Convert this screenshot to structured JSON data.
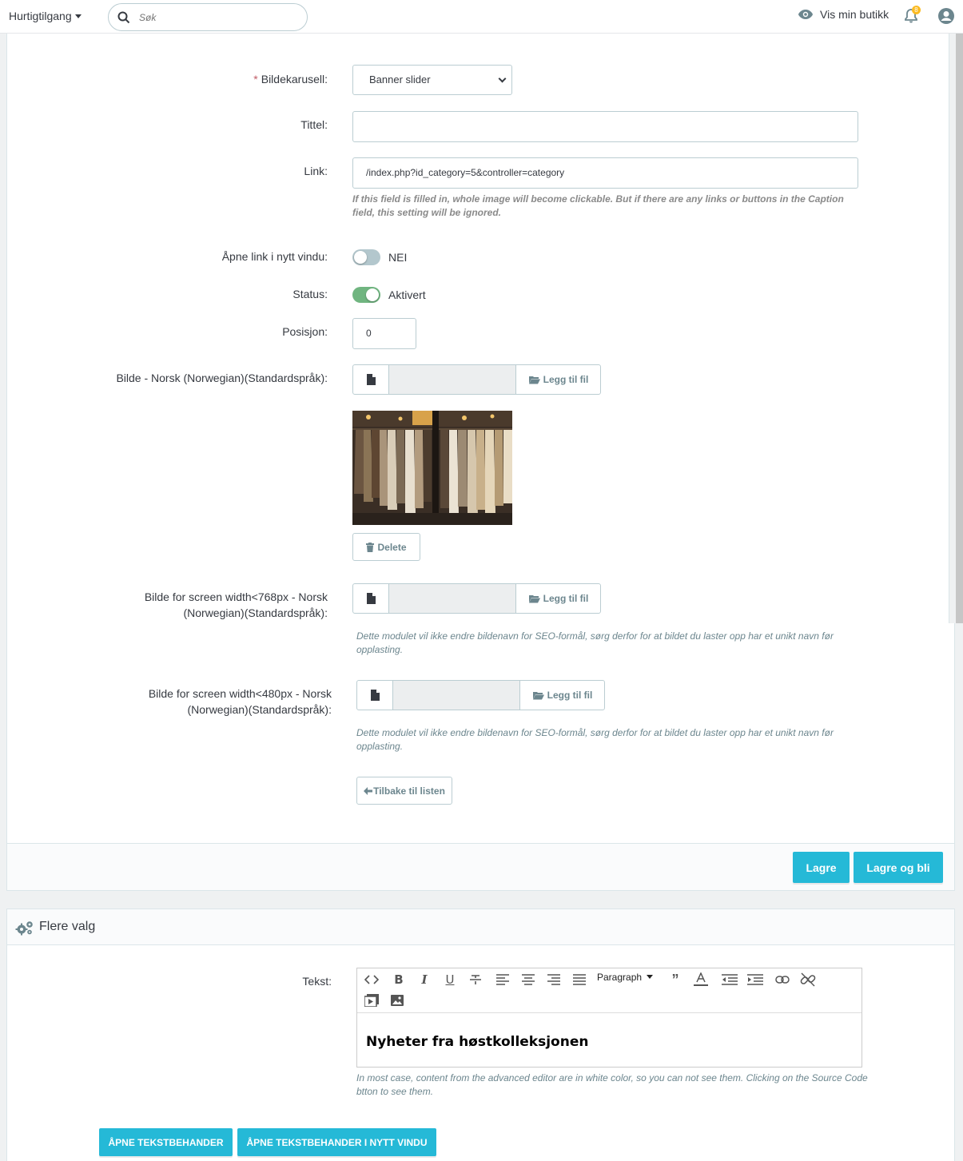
{
  "topbar": {
    "quick_access": "Hurtigtilgang",
    "search_placeholder": "Søk",
    "view_shop": "Vis min butikk",
    "notification_count": "8"
  },
  "form": {
    "carousel_label": "Bildekarusell:",
    "carousel_value": "Banner slider",
    "title_label": "Tittel:",
    "title_value": "",
    "link_label": "Link:",
    "link_value": "/index.php?id_category=5&controller=category",
    "link_help": "If this field is filled in, whole image will become clickable. But if there are any links or buttons in the Caption field, this setting will be ignored.",
    "new_window_label": "Åpne link i nytt vindu:",
    "new_window_value": "NEI",
    "status_label": "Status:",
    "status_value": "Aktivert",
    "position_label": "Posisjon:",
    "position_value": "0",
    "image_label": "Bilde - Norsk (Norwegian)(Standardspråk):",
    "add_file": "Legg til fil",
    "delete": "Delete",
    "image768_label_1": "Bilde for screen width<768px - Norsk",
    "image768_label_2": "(Norwegian)(Standardspråk):",
    "image480_label_1": "Bilde for screen width<480px - Norsk",
    "image480_label_2": "(Norwegian)(Standardspråk):",
    "seo_help": "Dette modulet vil ikke endre bildenavn for SEO-formål, sørg derfor for at bildet du laster opp har et unikt navn før opplasting.",
    "back_to_list": "Tilbake til listen"
  },
  "footer": {
    "save": "Lagre",
    "save_stay": "Lagre og bli"
  },
  "more_options": {
    "title": "Flere valg",
    "text_label": "Tekst:",
    "paragraph": "Paragraph",
    "content": "Nyheter fra høstkolleksjonen",
    "editor_help": "In most case, content from the advanced editor are in white color, so you can not see them. Clicking on the Source Code btton to see them.",
    "open_editor": "ÅPNE TEKSTBEHANDER",
    "open_editor_new": "ÅPNE TEKSTBEHANDER I NYTT VINDU"
  },
  "colors": {
    "primary": "#25b9d7",
    "toggle_on": "#70b580",
    "toggle_off": "#b3c7cd",
    "required": "#c05c67"
  }
}
